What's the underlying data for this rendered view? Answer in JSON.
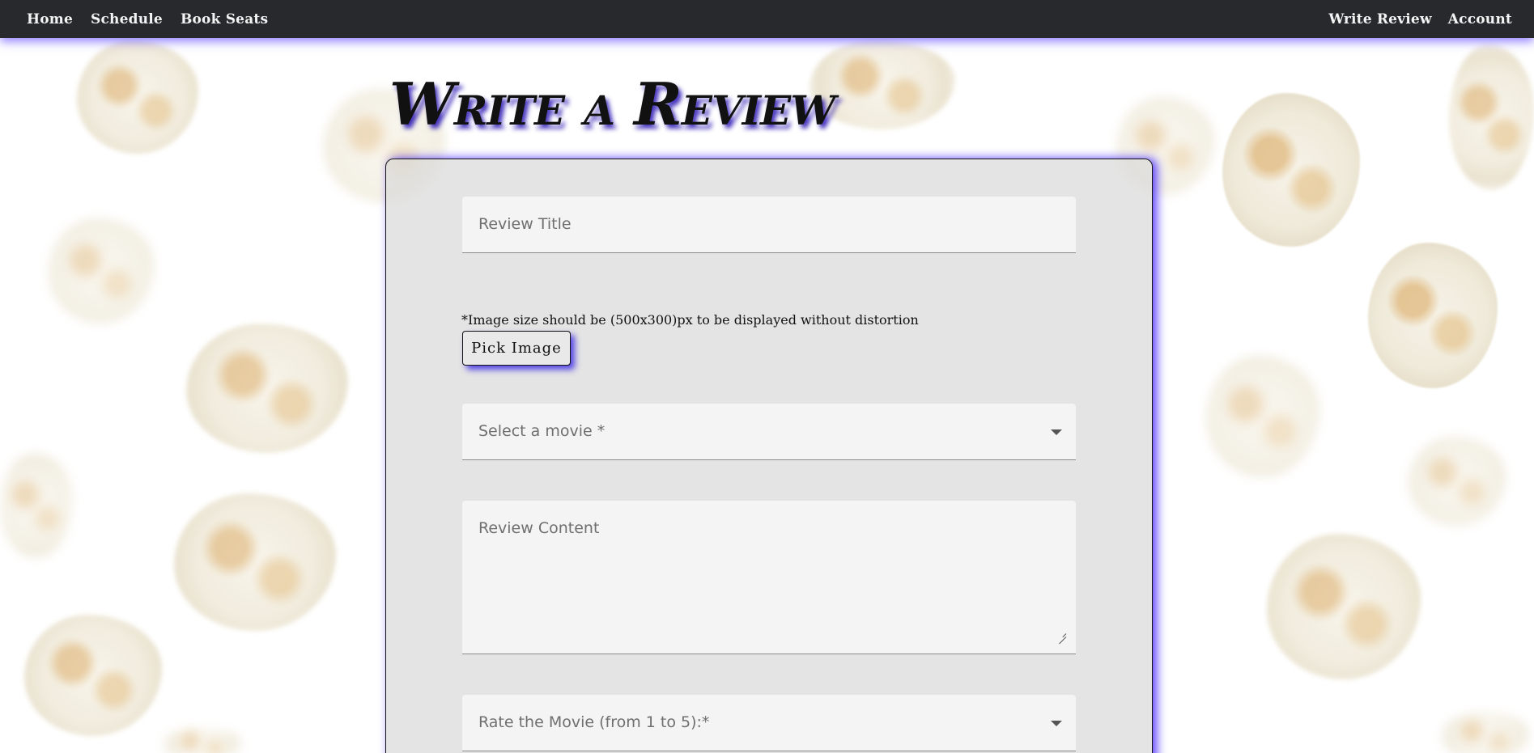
{
  "navbar": {
    "left_links": [
      "Home",
      "Schedule",
      "Book Seats"
    ],
    "right_links": [
      "Write Review",
      "Account"
    ]
  },
  "page": {
    "title": "Write a Review"
  },
  "form": {
    "review_title_placeholder": "Review Title",
    "image_note": "*Image size should be (500x300)px to be displayed without distortion",
    "pick_image_label": "Pick Image",
    "movie_select_placeholder": "Select a movie *",
    "review_content_placeholder": "Review Content",
    "rating_select_placeholder": "Rate the Movie (from 1 to 5):*"
  },
  "icons": {
    "dropdown": "chevron-down-icon",
    "resize": "resize-handle-icon"
  },
  "colors": {
    "navbar_bg": "#28292d",
    "accent_glow": "#3c1eff",
    "field_bg": "#f4f4f4"
  }
}
